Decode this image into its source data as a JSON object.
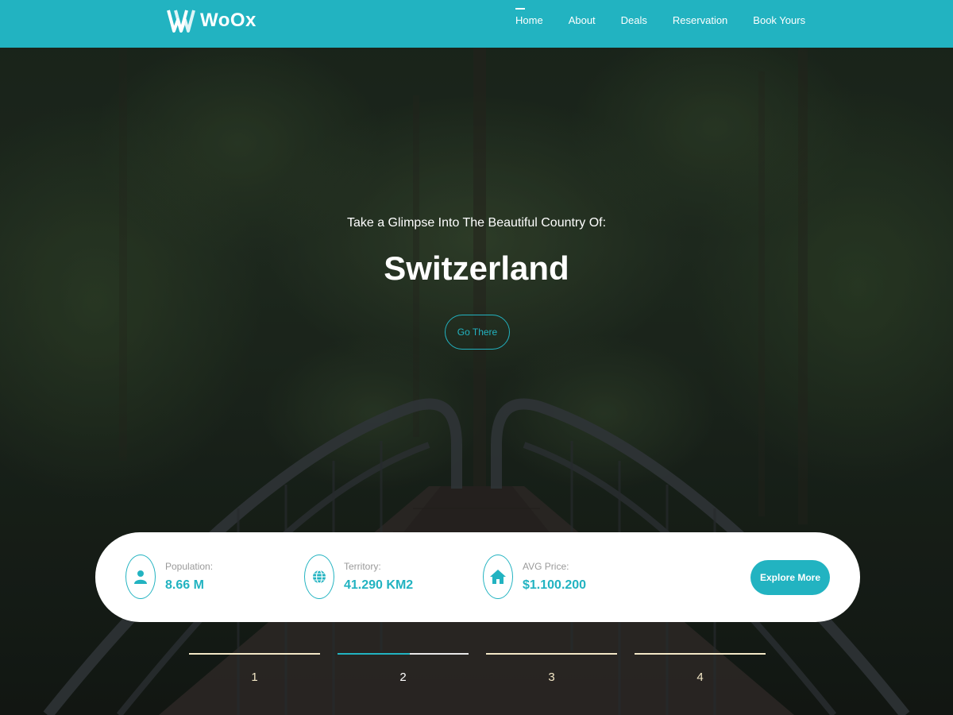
{
  "brand": {
    "name": "WoOx",
    "accent_color": "#22b3c1"
  },
  "nav": {
    "items": [
      {
        "label": "Home",
        "active": true
      },
      {
        "label": "About",
        "active": false
      },
      {
        "label": "Deals",
        "active": false
      },
      {
        "label": "Reservation",
        "active": false
      },
      {
        "label": "Book Yours",
        "active": false
      }
    ]
  },
  "hero": {
    "subtitle": "Take a Glimpse Into The Beautiful Country Of:",
    "title": "Switzerland",
    "button_label": "Go There"
  },
  "info": {
    "stats": [
      {
        "label": "Population:",
        "value": "8.66 M",
        "icon": "user-icon"
      },
      {
        "label": "Territory:",
        "value": "41.290 KM2",
        "icon": "globe-icon"
      },
      {
        "label": "AVG Price:",
        "value": "$1.100.200",
        "icon": "home-icon"
      }
    ],
    "explore_label": "Explore More"
  },
  "slider": {
    "active_index": 1,
    "active_progress": 0.55,
    "tabs": [
      "1",
      "2",
      "3",
      "4"
    ]
  }
}
